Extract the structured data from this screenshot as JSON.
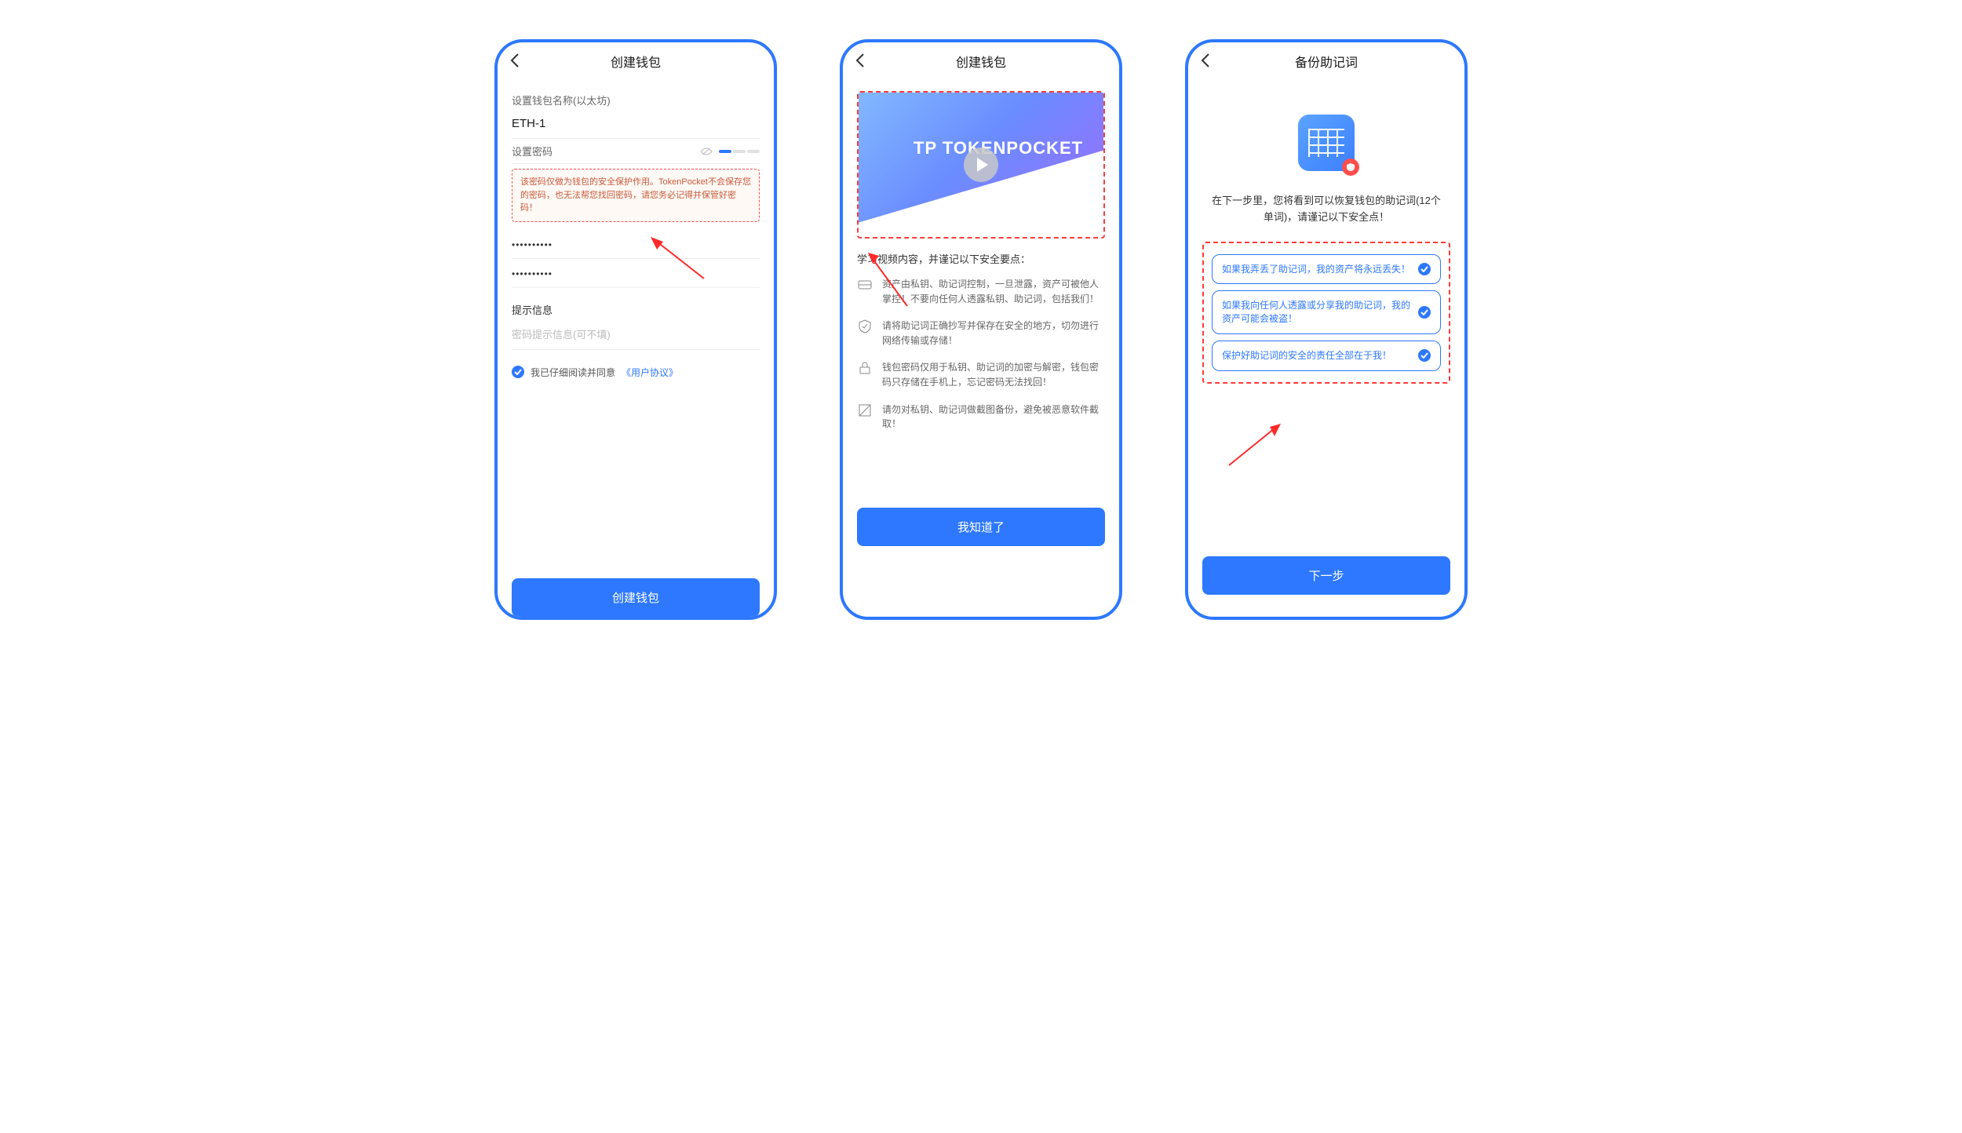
{
  "screen1": {
    "title": "创建钱包",
    "name_label": "设置钱包名称(以太坊)",
    "wallet_name": "ETH-1",
    "pw_label": "设置密码",
    "warning": "该密码仅做为钱包的安全保护作用。TokenPocket不会保存您的密码，也无法帮您找回密码，请您务必记得并保管好密码！",
    "pw1": "••••••••••",
    "pw2": "••••••••••",
    "hint_label": "提示信息",
    "hint_placeholder": "密码提示信息(可不填)",
    "agree_prefix": "我已仔细阅读并同意",
    "agree_link": "《用户协议》",
    "btn": "创建钱包"
  },
  "screen2": {
    "title": "创建钱包",
    "logo": "TP TOKENPOCKET",
    "tips_title": "学习视频内容，并谨记以下安全要点：",
    "tips": [
      "资产由私钥、助记词控制，一旦泄露，资产可被他人掌控！不要向任何人透露私钥、助记词，包括我们！",
      "请将助记词正确抄写并保存在安全的地方，切勿进行网络传输或存储！",
      "钱包密码仅用于私钥、助记词的加密与解密，钱包密码只存储在手机上，忘记密码无法找回！",
      "请勿对私钥、助记词做截图备份，避免被恶意软件截取！"
    ],
    "btn": "我知道了"
  },
  "screen3": {
    "title": "备份助记词",
    "intro": "在下一步里，您将看到可以恢复钱包的助记词(12个单词)，请谨记以下安全点！",
    "confirms": [
      "如果我弄丢了助记词，我的资产将永远丢失！",
      "如果我向任何人透露或分享我的助记词，我的资产可能会被盗！",
      "保护好助记词的安全的责任全部在于我！"
    ],
    "btn": "下一步"
  }
}
